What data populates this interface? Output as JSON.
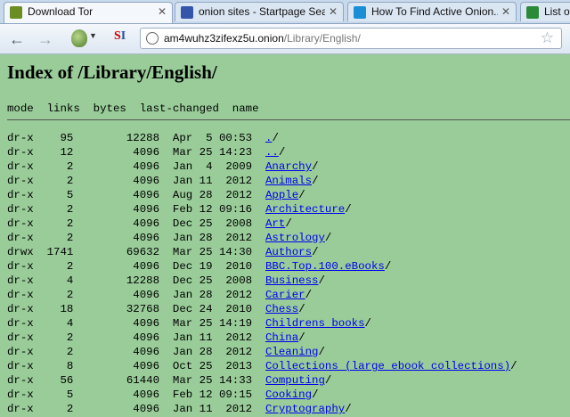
{
  "tabs": [
    {
      "title": "Download Tor",
      "icon": "tor-icon",
      "color": "#6b8e23",
      "active": true
    },
    {
      "title": "onion sites - Startpage Sea...",
      "icon": "startpage-icon",
      "color": "#3355aa",
      "active": false
    },
    {
      "title": "How To Find Active Onion...",
      "icon": "muo-icon",
      "color": "#1a8fd6",
      "active": false
    },
    {
      "title": "List of",
      "icon": "s-icon",
      "color": "#2a8a3a",
      "active": false
    }
  ],
  "toolbar": {
    "url_host": "am4wuhz3zifexz5u.onion",
    "url_path": "/Library/English/"
  },
  "page": {
    "title": "Index of /Library/English/",
    "header_line": "mode  links  bytes  last-changed  name"
  },
  "listing": [
    {
      "mode": "dr-x",
      "links": "95",
      "bytes": "12288",
      "date": "Apr  5 00:53",
      "name": "./",
      "link": "."
    },
    {
      "mode": "dr-x",
      "links": "12",
      "bytes": "4096",
      "date": "Mar 25 14:23",
      "name": "../",
      "link": ".."
    },
    {
      "mode": "dr-x",
      "links": "2",
      "bytes": "4096",
      "date": "Jan  4  2009",
      "name": "Anarchy",
      "link": "Anarchy"
    },
    {
      "mode": "dr-x",
      "links": "2",
      "bytes": "4096",
      "date": "Jan 11  2012",
      "name": "Animals",
      "link": "Animals"
    },
    {
      "mode": "dr-x",
      "links": "5",
      "bytes": "4096",
      "date": "Aug 28  2012",
      "name": "Apple",
      "link": "Apple"
    },
    {
      "mode": "dr-x",
      "links": "2",
      "bytes": "4096",
      "date": "Feb 12 09:16",
      "name": "Architecture",
      "link": "Architecture"
    },
    {
      "mode": "dr-x",
      "links": "2",
      "bytes": "4096",
      "date": "Dec 25  2008",
      "name": "Art",
      "link": "Art"
    },
    {
      "mode": "dr-x",
      "links": "2",
      "bytes": "4096",
      "date": "Jan 28  2012",
      "name": "Astrology",
      "link": "Astrology"
    },
    {
      "mode": "drwx",
      "links": "1741",
      "bytes": "69632",
      "date": "Mar 25 14:30",
      "name": "Authors",
      "link": "Authors"
    },
    {
      "mode": "dr-x",
      "links": "2",
      "bytes": "4096",
      "date": "Dec 19  2010",
      "name": "BBC.Top.100.eBooks",
      "link": "BBC.Top.100.eBooks"
    },
    {
      "mode": "dr-x",
      "links": "4",
      "bytes": "12288",
      "date": "Dec 25  2008",
      "name": "Business",
      "link": "Business"
    },
    {
      "mode": "dr-x",
      "links": "2",
      "bytes": "4096",
      "date": "Jan 28  2012",
      "name": "Carier",
      "link": "Carier"
    },
    {
      "mode": "dr-x",
      "links": "18",
      "bytes": "32768",
      "date": "Dec 24  2010",
      "name": "Chess",
      "link": "Chess"
    },
    {
      "mode": "dr-x",
      "links": "4",
      "bytes": "4096",
      "date": "Mar 25 14:19",
      "name": "Childrens books",
      "link": "Childrens books"
    },
    {
      "mode": "dr-x",
      "links": "2",
      "bytes": "4096",
      "date": "Jan 11  2012",
      "name": "China",
      "link": "China"
    },
    {
      "mode": "dr-x",
      "links": "2",
      "bytes": "4096",
      "date": "Jan 28  2012",
      "name": "Cleaning",
      "link": "Cleaning"
    },
    {
      "mode": "dr-x",
      "links": "8",
      "bytes": "4096",
      "date": "Oct 25  2013",
      "name": "Collections (large ebook collections)",
      "link": "Collections (large ebook collections)"
    },
    {
      "mode": "dr-x",
      "links": "56",
      "bytes": "61440",
      "date": "Mar 25 14:33",
      "name": "Computing",
      "link": "Computing"
    },
    {
      "mode": "dr-x",
      "links": "5",
      "bytes": "4096",
      "date": "Feb 12 09:15",
      "name": "Cooking",
      "link": "Cooking"
    },
    {
      "mode": "dr-x",
      "links": "2",
      "bytes": "4096",
      "date": "Jan 11  2012",
      "name": "Cryptography",
      "link": "Cryptography"
    }
  ]
}
